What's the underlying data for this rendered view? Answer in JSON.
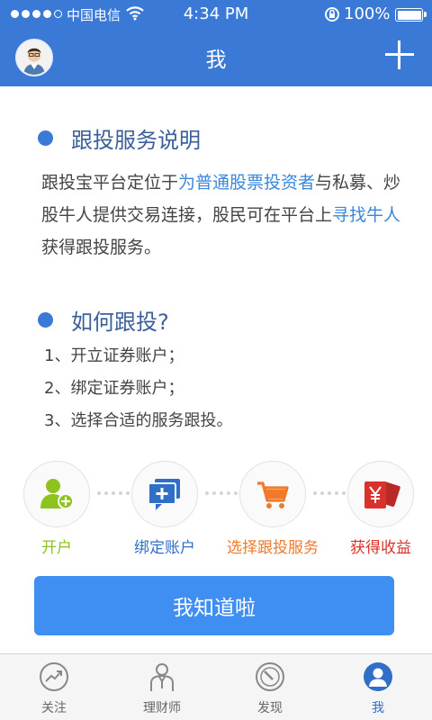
{
  "status_bar": {
    "carrier": "中国电信",
    "time": "4:34 PM",
    "battery": "100%"
  },
  "nav": {
    "title": "我"
  },
  "section1": {
    "title": "跟投服务说明",
    "text_1": "跟投宝平台定位于",
    "highlight_1": "为普通股票投资者",
    "text_2": "与私募、炒股牛人提供交易连接，股民可在平台上",
    "highlight_2": "寻找牛人",
    "text_3": "获得跟投服务。"
  },
  "section2": {
    "title": "如何跟投?",
    "steps": [
      "1、开立证券账户；",
      "2、绑定证券账户；",
      "3、选择合适的服务跟投。"
    ]
  },
  "flow": [
    {
      "label": "开户",
      "icon": "add-user-icon",
      "color": "#8dc21f"
    },
    {
      "label": "绑定账户",
      "icon": "bind-account-icon",
      "color": "#2f6fc7"
    },
    {
      "label": "选择跟投服务",
      "icon": "shopping-cart-icon",
      "color": "#f07a2a"
    },
    {
      "label": "获得收益",
      "icon": "yen-wallet-icon",
      "color": "#d9322d"
    }
  ],
  "primary_button": {
    "label": "我知道啦"
  },
  "tabbar": {
    "items": [
      {
        "label": "关注",
        "icon": "trend-icon"
      },
      {
        "label": "理财师",
        "icon": "advisor-icon"
      },
      {
        "label": "发现",
        "icon": "compass-icon"
      },
      {
        "label": "我",
        "icon": "profile-icon"
      }
    ],
    "active": "我"
  },
  "colors": {
    "header": "#3a7ad6",
    "accent": "#3a87dd",
    "button": "#3f8ff3"
  }
}
